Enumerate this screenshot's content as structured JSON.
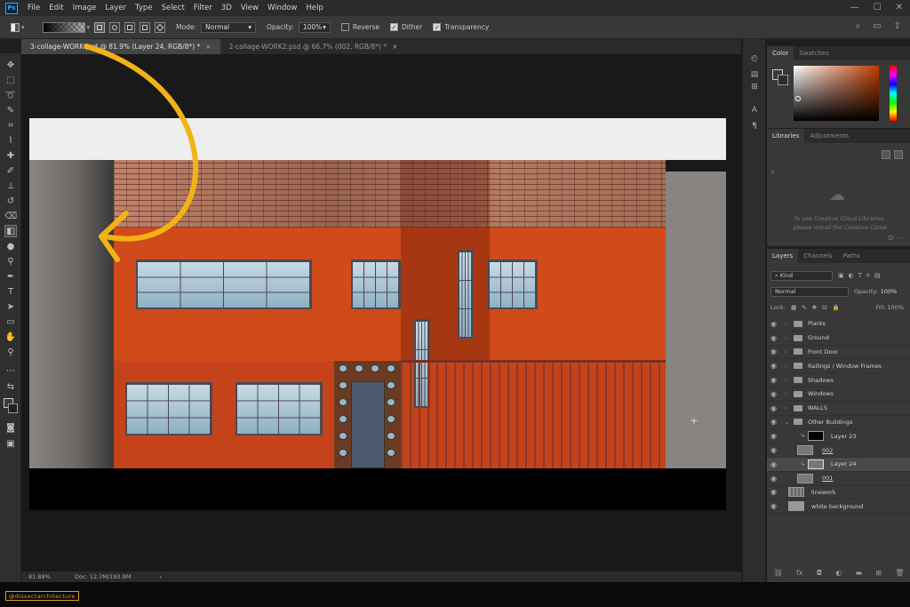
{
  "menubar": {
    "logo": "Ps",
    "items": [
      "File",
      "Edit",
      "Image",
      "Layer",
      "Type",
      "Select",
      "Filter",
      "3D",
      "View",
      "Window",
      "Help"
    ],
    "window_controls": [
      "—",
      "☐",
      "✕"
    ]
  },
  "options": {
    "mode_label": "Mode:",
    "mode_value": "Normal",
    "opacity_label": "Opacity:",
    "opacity_value": "100%",
    "reverse_label": "Reverse",
    "reverse_checked": false,
    "dither_label": "Dither",
    "dither_checked": true,
    "transparency_label": "Transparency",
    "transparency_checked": true
  },
  "tabs": [
    {
      "label": "3-collage-WORK.psd @ 81.9% (Layer 24, RGB/8*) *",
      "active": true
    },
    {
      "label": "2-collage-WORK2.psd @ 66.7% (002, RGB/8*) *",
      "active": false
    }
  ],
  "tab_close": "×",
  "status": {
    "zoom": "81.88%",
    "doc": "Doc: 12.7M/193.9M",
    "chevron": "›"
  },
  "color_panel": {
    "tabs": [
      "Color",
      "Swatches"
    ],
    "hue_color": "#c13a00"
  },
  "libraries_panel": {
    "tabs": [
      "Libraries",
      "Adjustments"
    ],
    "message_line1": "To use Creative Cloud Libraries,",
    "message_line2": "please install the Creative Cloud"
  },
  "layers_panel": {
    "tabs": [
      "Layers",
      "Channels",
      "Paths"
    ],
    "kind_label": "Kind",
    "blend_mode": "Normal",
    "opacity_label": "Opacity:",
    "opacity_value": "100%",
    "lock_label": "Lock:",
    "fill_label": "Fill:",
    "fill_value": "100%",
    "layers": [
      {
        "name": "Plants",
        "type": "folder"
      },
      {
        "name": "Ground",
        "type": "folder"
      },
      {
        "name": "Front Door",
        "type": "folder"
      },
      {
        "name": "Railings / Window Frames",
        "type": "folder"
      },
      {
        "name": "Shadows",
        "type": "folder"
      },
      {
        "name": "Windows",
        "type": "folder"
      },
      {
        "name": "WALLS",
        "type": "folder"
      },
      {
        "name": "Other Buildings",
        "type": "folder-open"
      },
      {
        "name": "Layer 23",
        "type": "clipped-black"
      },
      {
        "name": "002",
        "type": "layer-indent"
      },
      {
        "name": "Layer 24",
        "type": "clipped-selected"
      },
      {
        "name": "001",
        "type": "layer-indent"
      },
      {
        "name": "linework",
        "type": "pattern"
      },
      {
        "name": "white background",
        "type": "layer"
      }
    ]
  },
  "watermark": "@dissectarchitecture",
  "colors": {
    "accent_arrow": "#f2b316",
    "wall_orange": "#cf4a1c",
    "window_blue": "#a9c5d6",
    "ui_dark": "#2b2b2b"
  }
}
